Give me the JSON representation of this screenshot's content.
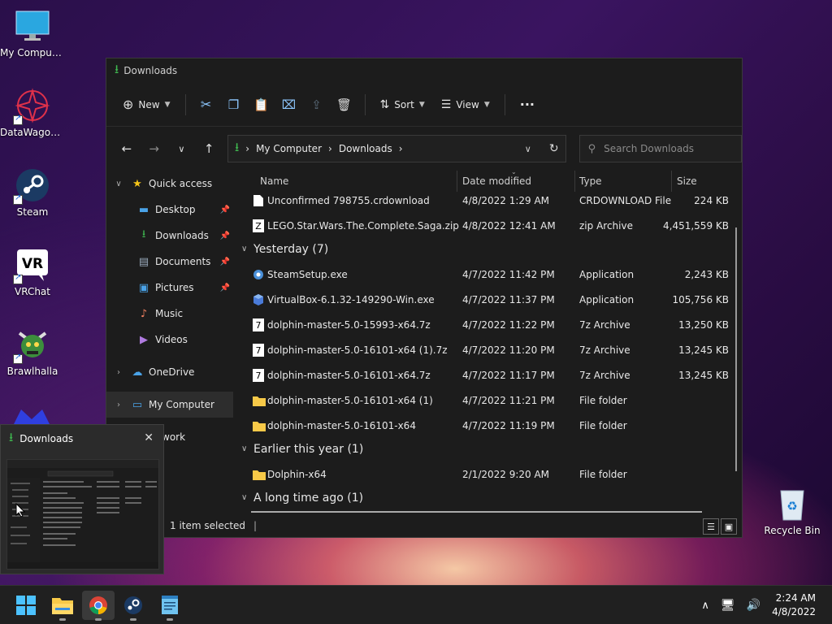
{
  "desktop": {
    "icons": [
      {
        "label": "My Computer"
      },
      {
        "label": "DataWagon..."
      },
      {
        "label": "Steam"
      },
      {
        "label": "VRChat"
      },
      {
        "label": "Brawlhalla"
      },
      {
        "label": "Recycle Bin"
      }
    ]
  },
  "window": {
    "title": "Downloads",
    "toolbar": {
      "new_label": "New",
      "sort_label": "Sort",
      "view_label": "View"
    },
    "address": {
      "crumbs": [
        "My Computer",
        "Downloads"
      ]
    },
    "search": {
      "placeholder": "Search Downloads"
    },
    "sidebar": {
      "items": [
        {
          "label": "Quick access"
        },
        {
          "label": "Desktop"
        },
        {
          "label": "Downloads"
        },
        {
          "label": "Documents"
        },
        {
          "label": "Pictures"
        },
        {
          "label": "Music"
        },
        {
          "label": "Videos"
        },
        {
          "label": "OneDrive"
        },
        {
          "label": "My Computer"
        },
        {
          "label": "work"
        }
      ]
    },
    "columns": {
      "name": "Name",
      "date": "Date modified",
      "type": "Type",
      "size": "Size"
    },
    "rows_top": [
      {
        "name": "Unconfirmed 798755.crdownload",
        "date": "4/8/2022 1:29 AM",
        "type": "CRDOWNLOAD File",
        "size": "224 KB"
      },
      {
        "name": "LEGO.Star.Wars.The.Complete.Saga.zip",
        "date": "4/8/2022 12:41 AM",
        "type": "zip Archive",
        "size": "4,451,559 KB"
      }
    ],
    "groups": [
      {
        "label": "Yesterday (7)"
      },
      {
        "label": "Earlier this year (1)"
      },
      {
        "label": "A long time ago (1)"
      }
    ],
    "rows_yesterday": [
      {
        "name": "SteamSetup.exe",
        "date": "4/7/2022 11:42 PM",
        "type": "Application",
        "size": "2,243 KB"
      },
      {
        "name": "VirtualBox-6.1.32-149290-Win.exe",
        "date": "4/7/2022 11:37 PM",
        "type": "Application",
        "size": "105,756 KB"
      },
      {
        "name": "dolphin-master-5.0-15993-x64.7z",
        "date": "4/7/2022 11:22 PM",
        "type": "7z Archive",
        "size": "13,250 KB"
      },
      {
        "name": "dolphin-master-5.0-16101-x64 (1).7z",
        "date": "4/7/2022 11:20 PM",
        "type": "7z Archive",
        "size": "13,245 KB"
      },
      {
        "name": "dolphin-master-5.0-16101-x64.7z",
        "date": "4/7/2022 11:17 PM",
        "type": "7z Archive",
        "size": "13,245 KB"
      },
      {
        "name": "dolphin-master-5.0-16101-x64 (1)",
        "date": "4/7/2022 11:21 PM",
        "type": "File folder",
        "size": ""
      },
      {
        "name": "dolphin-master-5.0-16101-x64",
        "date": "4/7/2022 11:19 PM",
        "type": "File folder",
        "size": ""
      }
    ],
    "rows_earlier": [
      {
        "name": "Dolphin-x64",
        "date": "2/1/2022 9:20 AM",
        "type": "File folder",
        "size": ""
      }
    ],
    "status": "1 item selected"
  },
  "thumbnail": {
    "title": "Downloads"
  },
  "taskbar": {
    "time": "2:24 AM",
    "date": "4/8/2022"
  },
  "colors": {
    "accent": "#4cc2ff",
    "folder": "#f7c948",
    "download_green": "#3fb950"
  }
}
